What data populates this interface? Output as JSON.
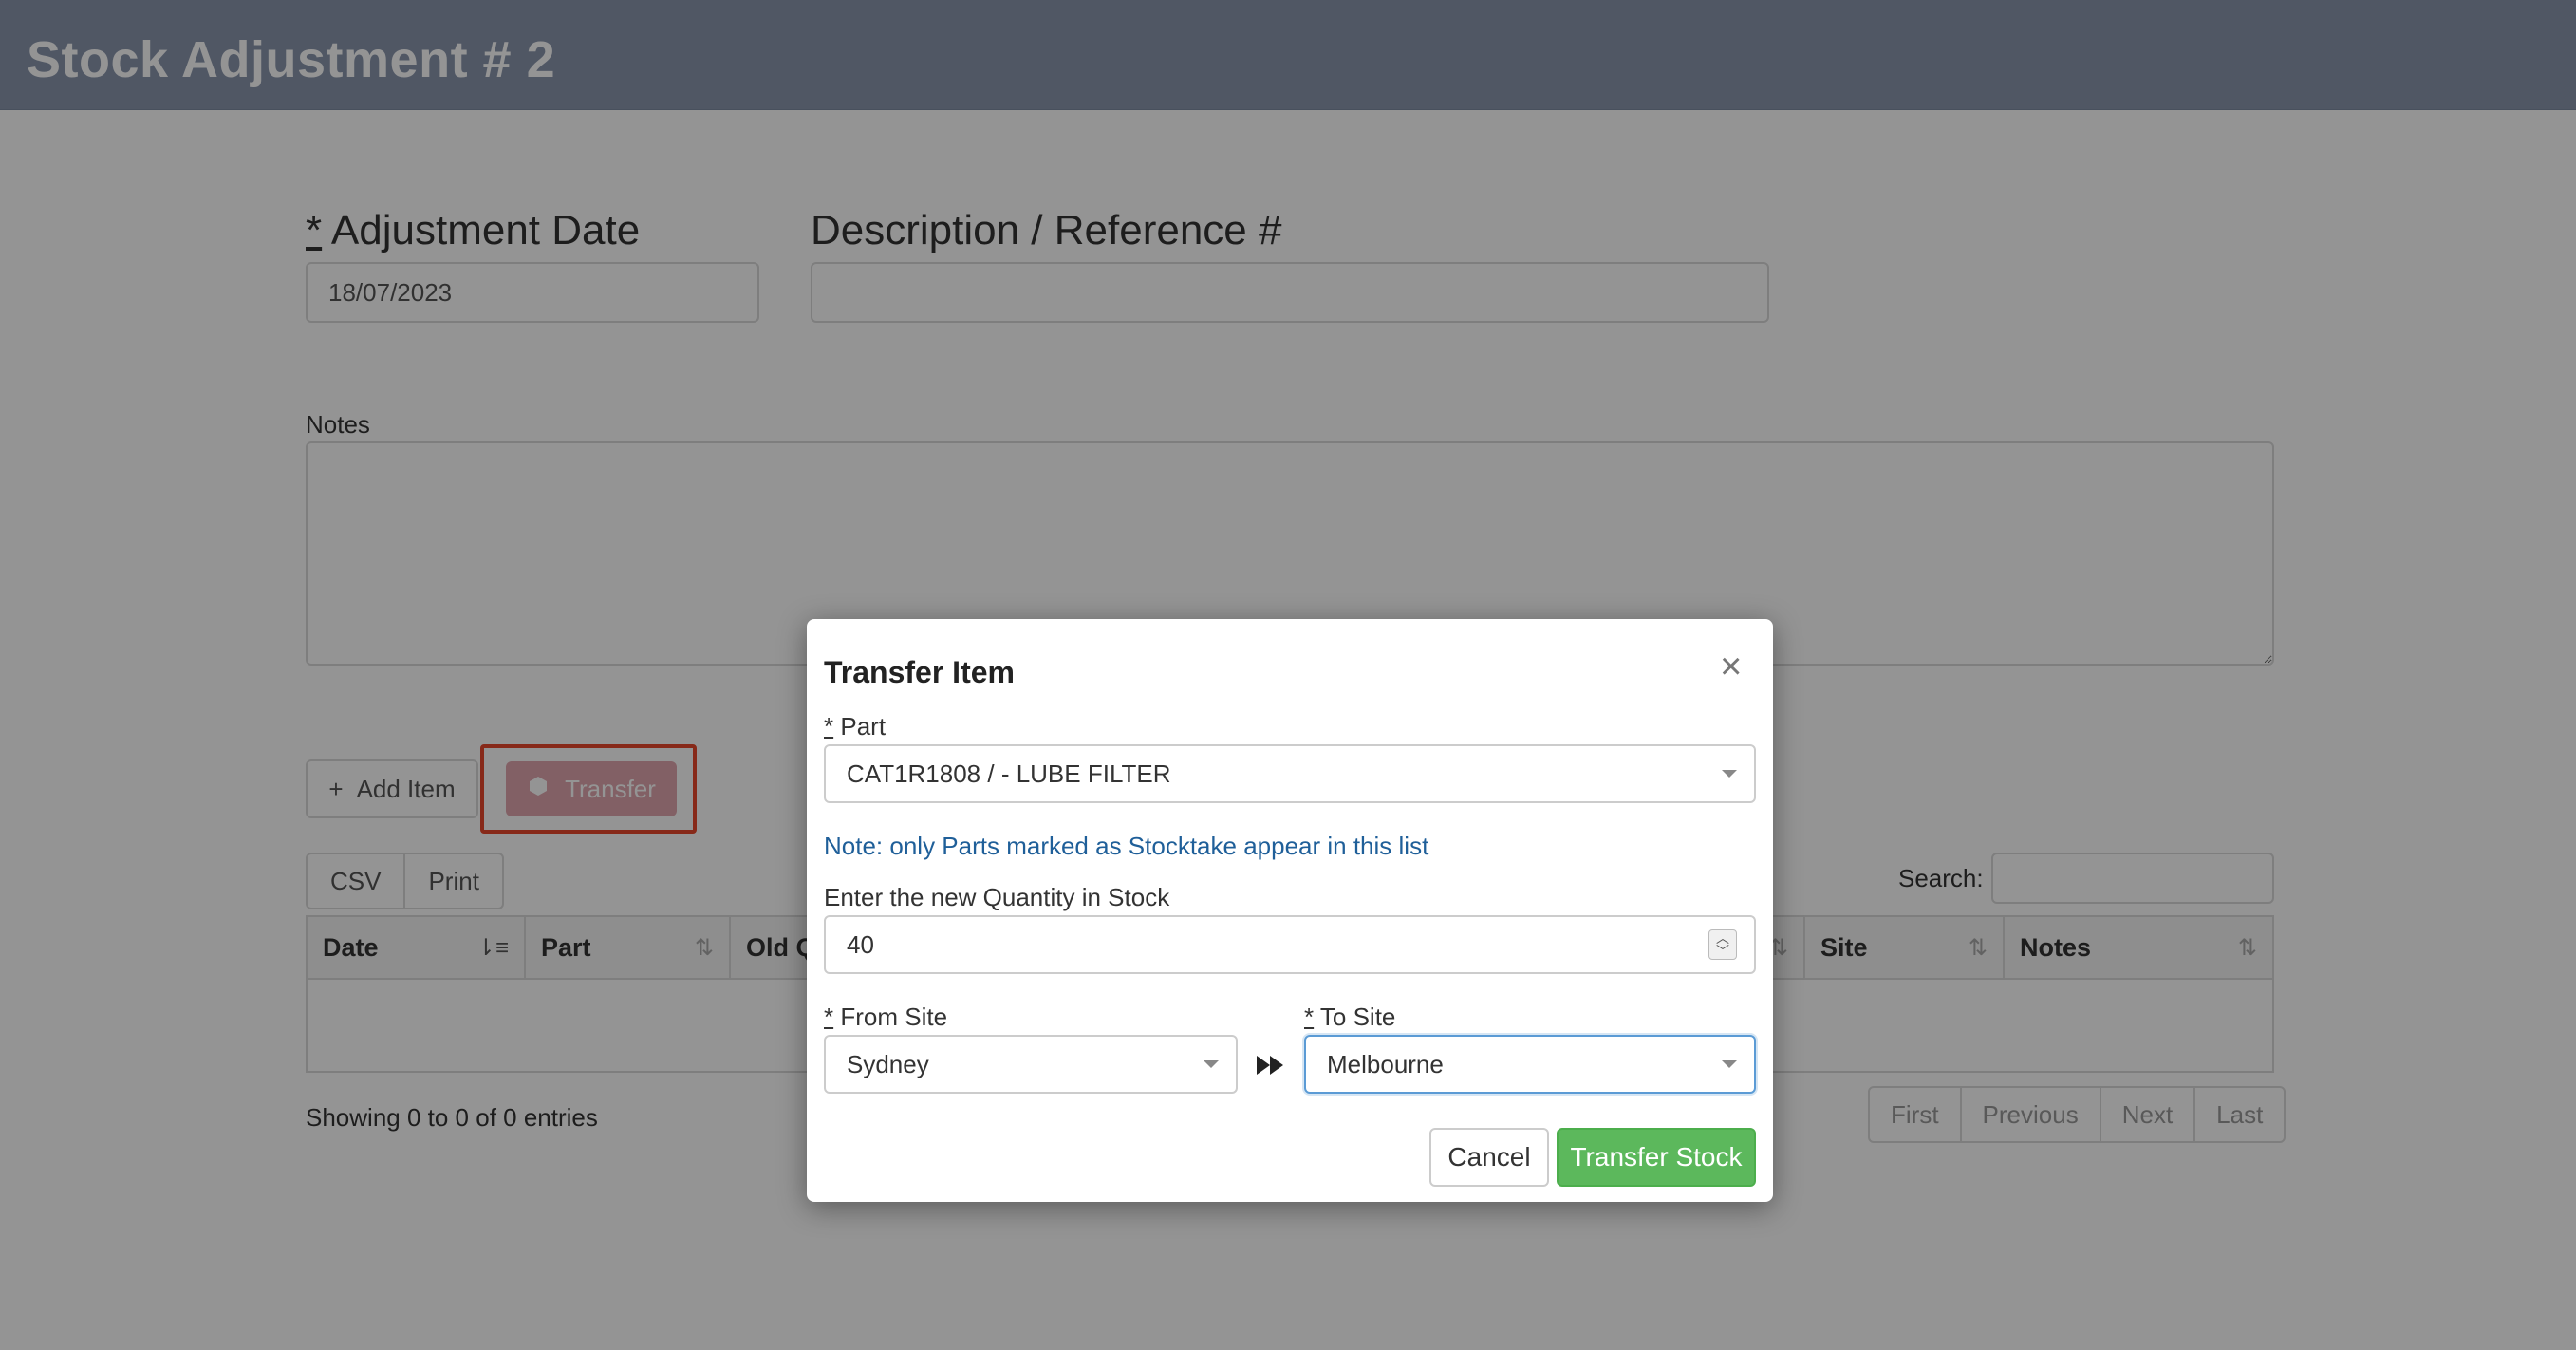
{
  "page": {
    "title": "Stock Adjustment # 2"
  },
  "form": {
    "adjustment_date": {
      "required_mark": "*",
      "label": "Adjustment Date",
      "value": "18/07/2023"
    },
    "description": {
      "label": "Description / Reference #",
      "value": ""
    },
    "notes": {
      "label": "Notes",
      "value": ""
    }
  },
  "actions": {
    "add_item_label": "Add Item",
    "transfer_label": "Transfer"
  },
  "table": {
    "export_buttons": [
      "CSV",
      "Print"
    ],
    "search_label": "Search:",
    "columns": [
      "Date",
      "Part",
      "Old Q",
      "Site",
      "Notes"
    ],
    "showing": "Showing 0 to 0 of 0 entries",
    "pager": [
      "First",
      "Previous",
      "Next",
      "Last"
    ]
  },
  "modal": {
    "title": "Transfer Item",
    "close": "×",
    "part": {
      "required_mark": "*",
      "label": "Part",
      "value": "CAT1R1808 / - LUBE FILTER"
    },
    "note": "Note: only Parts marked as Stocktake appear in this list",
    "quantity": {
      "label": "Enter the new Quantity in Stock",
      "value": "40"
    },
    "from_site": {
      "required_mark": "*",
      "label": "From Site",
      "value": "Sydney"
    },
    "to_site": {
      "required_mark": "*",
      "label": "To Site",
      "value": "Melbourne"
    },
    "cancel_label": "Cancel",
    "submit_label": "Transfer Stock"
  },
  "colors": {
    "header_bg": "#8a96ad",
    "primary_green": "#5cb85c",
    "highlight_red": "#e8472b",
    "note_blue": "#1f5f99"
  }
}
